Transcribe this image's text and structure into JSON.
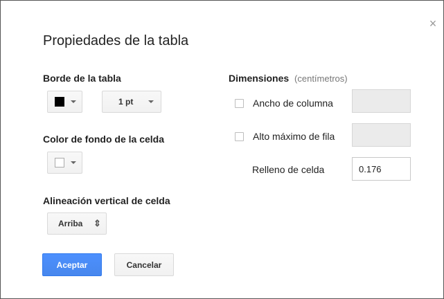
{
  "dialog": {
    "title": "Propiedades de la tabla",
    "close_glyph": "×",
    "border": {
      "label": "Borde de la tabla",
      "color_value": "#000000",
      "width_value": "1 pt"
    },
    "cell_bg": {
      "label": "Color de fondo de la celda",
      "color_value": "#ffffff"
    },
    "valign": {
      "label": "Alineación vertical de celda",
      "value": "Arriba",
      "arrows_glyph": "⇕"
    },
    "dimensions": {
      "label": "Dimensiones",
      "unit": "(centímetros)",
      "column_width": {
        "label": "Ancho de columna",
        "checked": false,
        "value": ""
      },
      "max_row_height": {
        "label": "Alto máximo de fila",
        "checked": false,
        "value": ""
      },
      "cell_padding": {
        "label": "Relleno de celda",
        "value": "0.176"
      }
    },
    "buttons": {
      "accept": "Aceptar",
      "cancel": "Cancelar"
    },
    "colors": {
      "accent": "#4d90fe",
      "accent_border": "#3079ed"
    }
  }
}
